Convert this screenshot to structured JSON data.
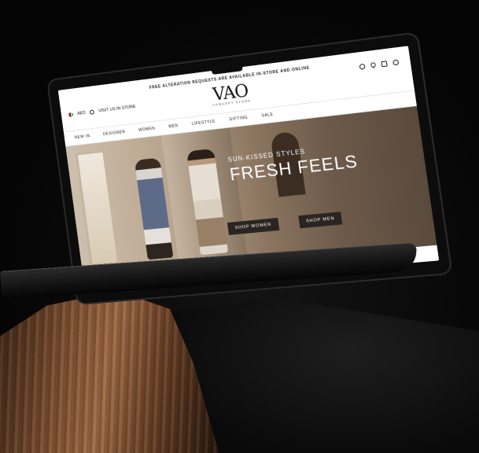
{
  "announcement": "FREE ALTERATION REQUESTS ARE AVAILABLE IN-STORE AND ONLINE",
  "brand": {
    "logo": "VAO",
    "tagline": "CONCEPT STORE"
  },
  "header": {
    "currency": "AED",
    "visit_store": "VISIT US IN STORE",
    "icons": [
      "search-icon",
      "heart-icon",
      "bag-icon",
      "user-icon"
    ]
  },
  "nav": {
    "items": [
      "NEW IN",
      "DESIGNER",
      "WOMEN",
      "MEN",
      "LIFESTYLE",
      "GIFTING",
      "SALE"
    ]
  },
  "hero": {
    "subtitle": "SUN-KISSED STYLES",
    "title": "FRESH FEELS",
    "buttons": [
      "SHOP WOMEN",
      "SHOP MEN"
    ]
  },
  "colors": {
    "hero_button": "#2b2522",
    "hero_text": "#ffffff"
  }
}
